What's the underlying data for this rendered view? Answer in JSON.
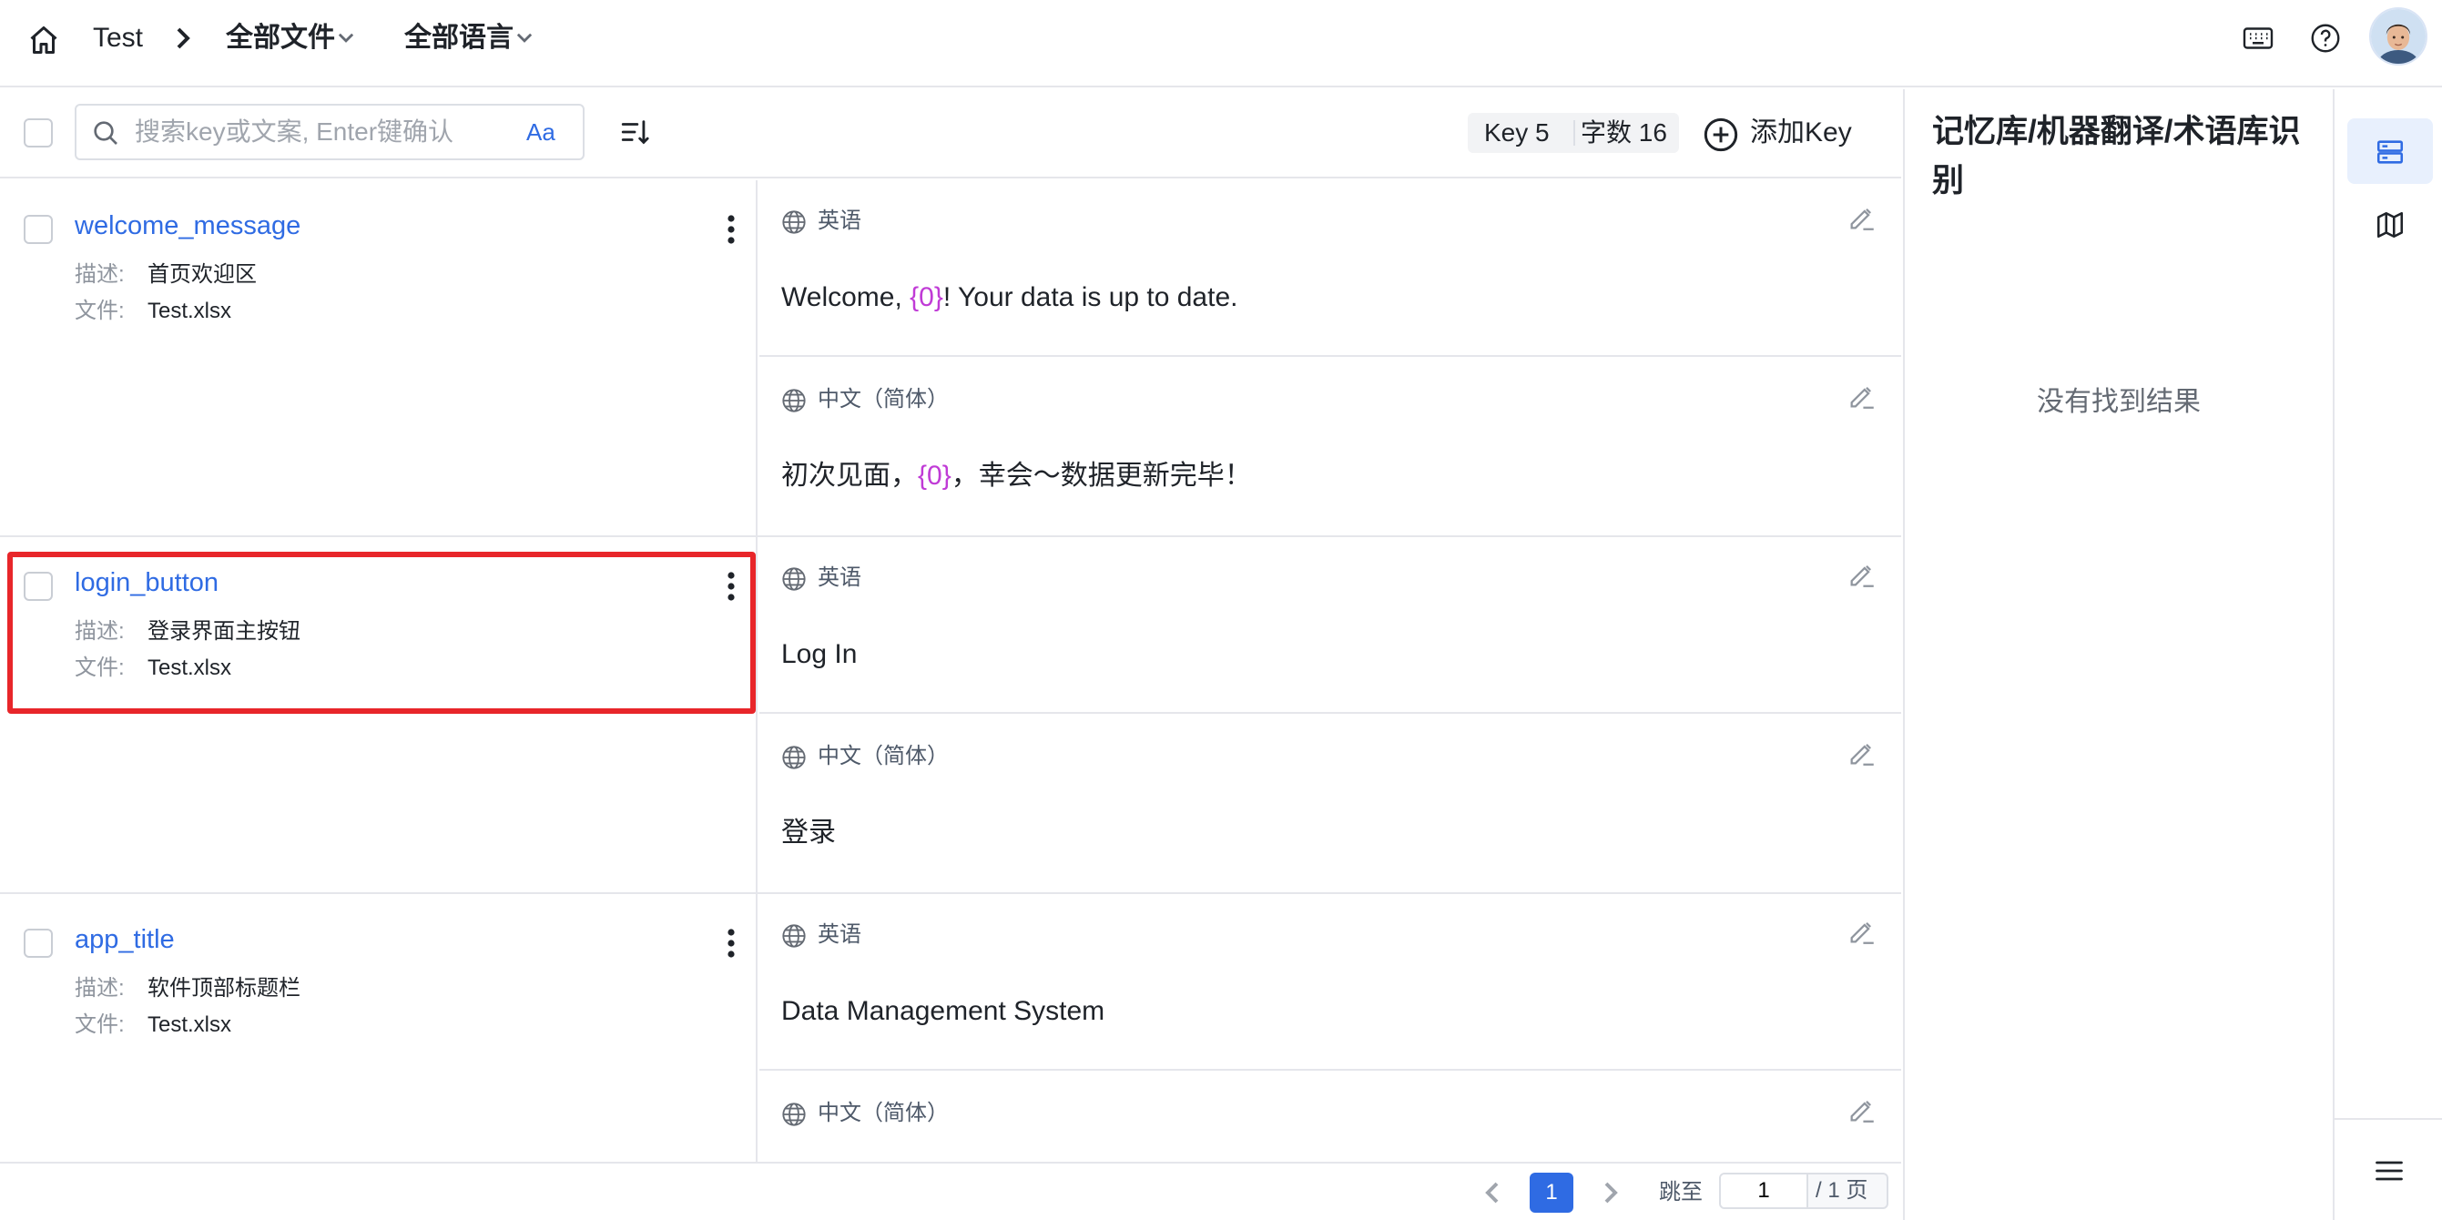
{
  "header": {
    "project": "Test",
    "files_filter": "全部文件",
    "langs_filter": "全部语言"
  },
  "toolbar": {
    "search_placeholder": "搜索key或文案, Enter键确认",
    "case_toggle": "Aa",
    "key_count": "Key 5",
    "char_count": "字数 16",
    "add_key": "添加Key"
  },
  "labels": {
    "desc": "描述:",
    "file": "文件:"
  },
  "entries": [
    {
      "key": "welcome_message",
      "desc": "首页欢迎区",
      "file": "Test.xlsx",
      "trans": [
        {
          "lang": "英语",
          "pre": "Welcome, ",
          "ph": "{0}",
          "post": "! Your data is up to date."
        },
        {
          "lang": "中文（简体）",
          "pre": "初次见面，",
          "ph": "{0}",
          "post": "，幸会～数据更新完毕！"
        }
      ]
    },
    {
      "key": "login_button",
      "desc": "登录界面主按钮",
      "file": "Test.xlsx",
      "trans": [
        {
          "lang": "英语",
          "pre": "Log In",
          "ph": "",
          "post": ""
        },
        {
          "lang": "中文（简体）",
          "pre": "登录",
          "ph": "",
          "post": ""
        }
      ]
    },
    {
      "key": "app_title",
      "desc": "软件顶部标题栏",
      "file": "Test.xlsx",
      "trans": [
        {
          "lang": "英语",
          "pre": "Data Management System",
          "ph": "",
          "post": ""
        },
        {
          "lang": "中文（简体）",
          "pre": "",
          "ph": "",
          "post": ""
        }
      ]
    }
  ],
  "pager": {
    "current": "1",
    "jump_label": "跳至",
    "jump_value": "1",
    "total": "/ 1 页"
  },
  "panel": {
    "title": "记忆库/机器翻译/术语库识别",
    "empty": "没有找到结果"
  },
  "colors": {
    "accent": "#2f6be3",
    "placeholder_token": "#c03bd6",
    "highlight": "#e8262a"
  }
}
